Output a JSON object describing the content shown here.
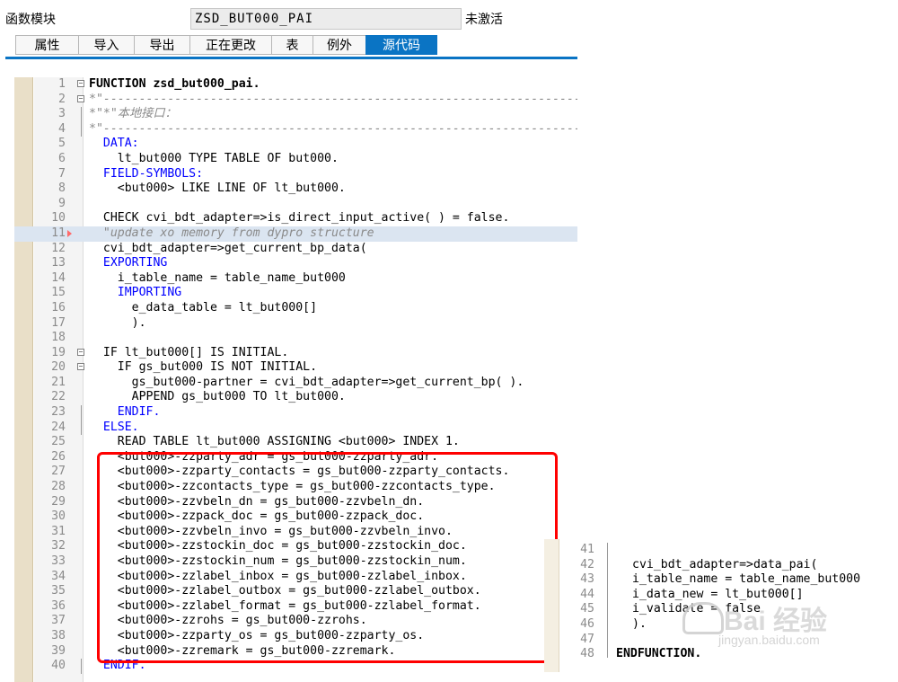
{
  "header": {
    "label": "函数模块",
    "function_name": "ZSD_BUT000_PAI",
    "status": "未激活"
  },
  "tabs": [
    {
      "label": "属性"
    },
    {
      "label": "导入"
    },
    {
      "label": "导出"
    },
    {
      "label": "正在更改"
    },
    {
      "label": "表"
    },
    {
      "label": "例外"
    },
    {
      "label": "源代码",
      "active": true
    }
  ],
  "code_lines": [
    {
      "num": "1",
      "text": "FUNCTION zsd_but000_pai.",
      "style": "bold"
    },
    {
      "num": "2",
      "text": "*\"--------------------------------------------------------------------",
      "style": "cm"
    },
    {
      "num": "3",
      "text": "*\"*\"本地接口：",
      "style": "cm"
    },
    {
      "num": "4",
      "text": "*\"--------------------------------------------------------------------",
      "style": "cm"
    },
    {
      "num": "5",
      "text": "  DATA:",
      "style": "kw"
    },
    {
      "num": "6",
      "text": "    lt_but000 TYPE TABLE OF but000.",
      "style": ""
    },
    {
      "num": "7",
      "text": "  FIELD-SYMBOLS:",
      "style": "kw"
    },
    {
      "num": "8",
      "text": "    <but000> LIKE LINE OF lt_but000.",
      "style": ""
    },
    {
      "num": "9",
      "text": "",
      "style": ""
    },
    {
      "num": "10",
      "text": "  CHECK cvi_bdt_adapter=>is_direct_input_active( ) = false.",
      "style": ""
    },
    {
      "num": "11",
      "text": "  \"update xo memory from dypro structure",
      "style": "cm"
    },
    {
      "num": "12",
      "text": "  cvi_bdt_adapter=>get_current_bp_data(",
      "style": ""
    },
    {
      "num": "13",
      "text": "  EXPORTING",
      "style": "kw"
    },
    {
      "num": "14",
      "text": "    i_table_name = table_name_but000",
      "style": ""
    },
    {
      "num": "15",
      "text": "    IMPORTING",
      "style": "kw"
    },
    {
      "num": "16",
      "text": "      e_data_table = lt_but000[]",
      "style": ""
    },
    {
      "num": "17",
      "text": "      ).",
      "style": ""
    },
    {
      "num": "18",
      "text": "",
      "style": ""
    },
    {
      "num": "19",
      "text": "  IF lt_but000[] IS INITIAL.",
      "style": ""
    },
    {
      "num": "20",
      "text": "    IF gs_but000 IS NOT INITIAL.",
      "style": ""
    },
    {
      "num": "21",
      "text": "      gs_but000-partner = cvi_bdt_adapter=>get_current_bp( ).",
      "style": ""
    },
    {
      "num": "22",
      "text": "      APPEND gs_but000 TO lt_but000.",
      "style": ""
    },
    {
      "num": "23",
      "text": "    ENDIF.",
      "style": "kw"
    },
    {
      "num": "24",
      "text": "  ELSE.",
      "style": "kw"
    },
    {
      "num": "25",
      "text": "    READ TABLE lt_but000 ASSIGNING <but000> INDEX 1.",
      "style": ""
    },
    {
      "num": "26",
      "text": "    <but000>-zzparty_adr = gs_but000-zzparty_adr.",
      "style": ""
    },
    {
      "num": "27",
      "text": "    <but000>-zzparty_contacts = gs_but000-zzparty_contacts.",
      "style": ""
    },
    {
      "num": "28",
      "text": "    <but000>-zzcontacts_type = gs_but000-zzcontacts_type.",
      "style": ""
    },
    {
      "num": "29",
      "text": "    <but000>-zzvbeln_dn = gs_but000-zzvbeln_dn.",
      "style": ""
    },
    {
      "num": "30",
      "text": "    <but000>-zzpack_doc = gs_but000-zzpack_doc.",
      "style": ""
    },
    {
      "num": "31",
      "text": "    <but000>-zzvbeln_invo = gs_but000-zzvbeln_invo.",
      "style": ""
    },
    {
      "num": "32",
      "text": "    <but000>-zzstockin_doc = gs_but000-zzstockin_doc.",
      "style": ""
    },
    {
      "num": "33",
      "text": "    <but000>-zzstockin_num = gs_but000-zzstockin_num.",
      "style": ""
    },
    {
      "num": "34",
      "text": "    <but000>-zzlabel_inbox = gs_but000-zzlabel_inbox.",
      "style": ""
    },
    {
      "num": "35",
      "text": "    <but000>-zzlabel_outbox = gs_but000-zzlabel_outbox.",
      "style": ""
    },
    {
      "num": "36",
      "text": "    <but000>-zzlabel_format = gs_but000-zzlabel_format.",
      "style": ""
    },
    {
      "num": "37",
      "text": "    <but000>-zzrohs = gs_but000-zzrohs.",
      "style": ""
    },
    {
      "num": "38",
      "text": "    <but000>-zzparty_os = gs_but000-zzparty_os.",
      "style": ""
    },
    {
      "num": "39",
      "text": "    <but000>-zzremark = gs_but000-zzremark.",
      "style": ""
    },
    {
      "num": "40",
      "text": "  ENDIF.",
      "style": "kw"
    }
  ],
  "inset_lines": [
    {
      "num": "41",
      "text": "",
      "style": ""
    },
    {
      "num": "42",
      "text": "cvi_bdt_adapter=>data_pai(",
      "style": ""
    },
    {
      "num": "43",
      "text": "i_table_name = table_name_but000",
      "style": ""
    },
    {
      "num": "44",
      "text": "i_data_new = lt_but000[]",
      "style": ""
    },
    {
      "num": "45",
      "text": "i_validate = false",
      "style": ""
    },
    {
      "num": "46",
      "text": ").",
      "style": ""
    },
    {
      "num": "47",
      "text": "",
      "style": ""
    },
    {
      "num": "48",
      "text": "ENDFUNCTION.",
      "style": "bold"
    }
  ],
  "watermark": {
    "text": "Bai 经验",
    "url": "jingyan.baidu.com"
  }
}
